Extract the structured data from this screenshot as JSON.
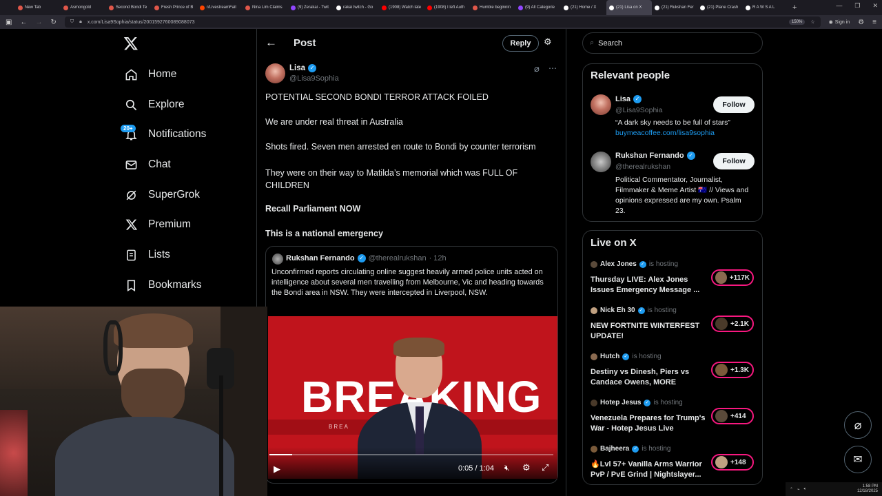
{
  "browser": {
    "tabs": [
      {
        "label": "New Tab",
        "color": "#e0574a"
      },
      {
        "label": "Asmongold",
        "color": "#e0574a"
      },
      {
        "label": "Second Bondi Te",
        "color": "#e0574a"
      },
      {
        "label": "Fresh Prince of B",
        "color": "#e0574a"
      },
      {
        "label": "r/LivestreamFail",
        "color": "#ff4500"
      },
      {
        "label": "Nina Lim Claims",
        "color": "#e0574a"
      },
      {
        "label": "(9) Zerakai - Twit",
        "color": "#9146ff"
      },
      {
        "label": "rakai twitch - Go",
        "color": "#ffffff"
      },
      {
        "label": "(1908) Watch late",
        "color": "#ff0000"
      },
      {
        "label": "(1908) I left Auth",
        "color": "#ff0000"
      },
      {
        "label": "Humble beginnin",
        "color": "#e0574a"
      },
      {
        "label": "(9) All Categorie",
        "color": "#9146ff"
      },
      {
        "label": "(21) Home / X",
        "color": "#ffffff"
      },
      {
        "label": "(21) Lisa on X",
        "color": "#ffffff"
      },
      {
        "label": "(21) Rukshan Fer",
        "color": "#ffffff"
      },
      {
        "label": "(21) Plane Crash",
        "color": "#ffffff"
      },
      {
        "label": "R A W S A L",
        "color": "#ffffff"
      }
    ],
    "new_tab": "+",
    "url": "x.com/Lisa9Sophia/status/2001592760089088073",
    "zoom": "150%",
    "signin": "Sign in"
  },
  "nav": {
    "items": [
      {
        "label": "Home",
        "icon": "home-icon"
      },
      {
        "label": "Explore",
        "icon": "search-icon"
      },
      {
        "label": "Notifications",
        "icon": "bell-icon"
      },
      {
        "label": "Chat",
        "icon": "mail-icon"
      },
      {
        "label": "SuperGrok",
        "icon": "grok-icon"
      },
      {
        "label": "Premium",
        "icon": "x-logo-icon"
      },
      {
        "label": "Lists",
        "icon": "list-icon"
      },
      {
        "label": "Bookmarks",
        "icon": "bookmark-icon"
      }
    ],
    "notif_badge": "20+"
  },
  "post": {
    "header_title": "Post",
    "reply_label": "Reply",
    "author": "Lisa",
    "handle": "@Lisa9Sophia",
    "paragraphs": [
      "POTENTIAL SECOND BONDI TERROR ATTACK FOILED",
      "We are under real threat in Australia",
      "Shots fired. Seven men arrested en route to Bondi by counter terrorism",
      "They were on their way to Matilda’s memorial which was FULL OF CHILDREN"
    ],
    "bold_paragraphs": [
      "Recall Parliament NOW",
      "This is a national emergency"
    ],
    "quote": {
      "author": "Rukshan Fernando",
      "handle": "@therealrukshan",
      "time": "· 12h",
      "text": "Unconfirmed reports circulating online suggest heavily armed police units acted on intelligence about several men travelling from Melbourne, Vic and heading towards the Bondi area in NSW.  They were intercepted in Liverpool, NSW."
    },
    "video": {
      "banner": "BREAKING",
      "ticker": "BREA          EAKING NEWS",
      "time": "0:05 / 1:04",
      "progress": 0.08
    }
  },
  "search": {
    "placeholder": "Search"
  },
  "relevant": {
    "title": "Relevant people",
    "follow_label": "Follow",
    "people": [
      {
        "name": "Lisa",
        "handle": "@Lisa9Sophia",
        "bio": "“A dark sky needs to be full of stars”",
        "link": "buymeacoffee.com/lisa9sophia"
      },
      {
        "name": "Rukshan Fernando",
        "handle": "@therealrukshan",
        "bio": "Political Commentator, Journalist, Filmmaker & Meme Artist 🇦🇺 // Views and opinions expressed are my own. Psalm 23."
      }
    ]
  },
  "live": {
    "title": "Live on X",
    "hosting_label": "is hosting",
    "items": [
      {
        "host": "Alex Jones",
        "title": "Thursday LIVE: Alex Jones Issues Emergency Message ...",
        "count": "+117K"
      },
      {
        "host": "Nick Eh 30",
        "title": "NEW FORTNITE WINTERFEST UPDATE!",
        "count": "+2.1K"
      },
      {
        "host": "Hutch",
        "title": "Destiny vs Dinesh, Piers vs Candace Owens, MORE",
        "count": "+1.3K"
      },
      {
        "host": "Hotep Jesus",
        "title": "Venezuela Prepares for Trump's War - Hotep Jesus Live",
        "count": "+414"
      },
      {
        "host": "Bajheera",
        "title": "🔥Lvl 57+ Vanilla Arms Warrior PvP / PvE Grind | Nightslayer...",
        "count": "+148"
      }
    ]
  },
  "taskbar": {
    "time": "1:58 PM",
    "date": "12/18/2025"
  }
}
